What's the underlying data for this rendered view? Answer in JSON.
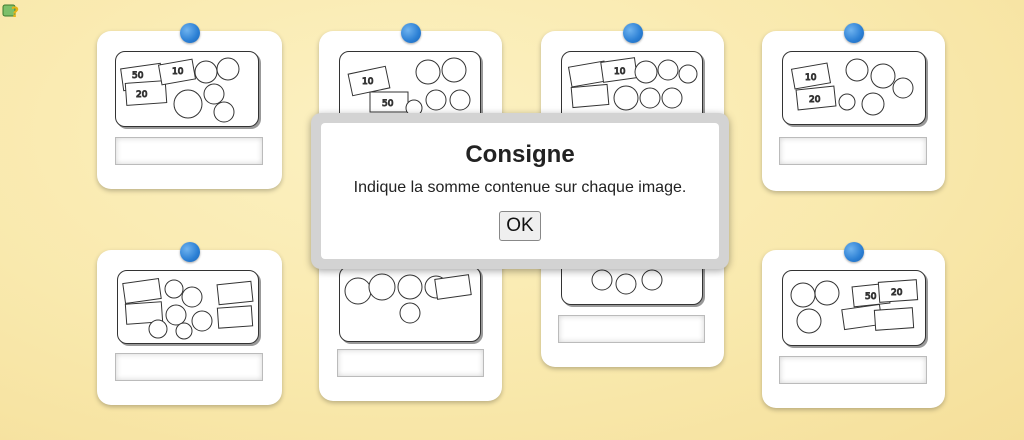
{
  "help": {
    "icon": "help-question-icon"
  },
  "colors": {
    "background": "#fbeeb8",
    "pin": "#2b7fd4",
    "card": "#ffffff"
  },
  "cards": [
    {
      "id": 1,
      "answer": "",
      "content": "banknotes-and-coins"
    },
    {
      "id": 2,
      "answer": "",
      "content": "banknotes-and-coins"
    },
    {
      "id": 3,
      "answer": "",
      "content": "banknotes-and-coins"
    },
    {
      "id": 4,
      "answer": "",
      "content": "banknotes-and-coins"
    },
    {
      "id": 5,
      "answer": "",
      "content": "banknotes-and-coins"
    },
    {
      "id": 6,
      "answer": "",
      "content": "coins"
    },
    {
      "id": 7,
      "answer": "",
      "content": "coins"
    },
    {
      "id": 8,
      "answer": "",
      "content": "banknotes-and-coins"
    }
  ],
  "dialog": {
    "title": "Consigne",
    "message": "Indique la somme contenue sur chaque image.",
    "ok_label": "OK"
  }
}
